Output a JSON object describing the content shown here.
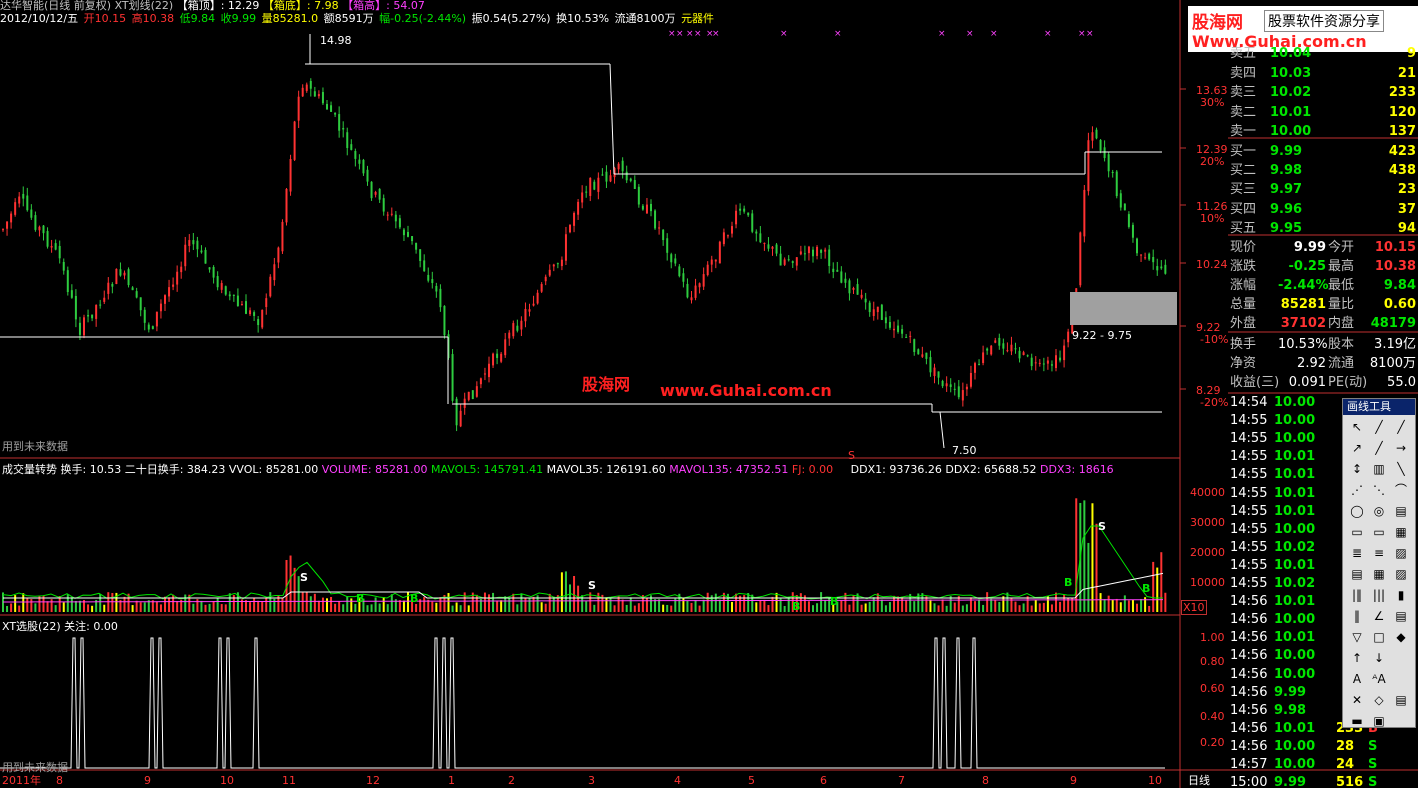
{
  "header": {
    "title": "达华智能(日线 前复权) XT划线(22)",
    "xiang_ding_label": "【箱顶】",
    "xiang_ding": "12.29",
    "xiang_di_label": "【箱底】",
    "xiang_di": "7.98",
    "xiang_gao_label": "【箱高】",
    "xiang_gao": "54.07"
  },
  "info": {
    "date": "2012/10/12/五",
    "open": "开10.15",
    "high": "高10.38",
    "low": "低9.84",
    "close": "收9.99",
    "vol": "量85281.0",
    "amount": "额8591万",
    "change": "幅-0.25(-2.44%)",
    "amp": "振0.54(5.27%)",
    "turnover": "换10.53%",
    "float": "流通8100万",
    "unit": "元器件"
  },
  "banner": {
    "site": "股海网",
    "slogan": "股票软件资源分享",
    "url": "Www.Guhai.com.cn"
  },
  "watermark": {
    "site": "股海网",
    "url": "www.Guhai.com.cn"
  },
  "main_labels": {
    "high_mark": "14.98",
    "low_mark": "7.50",
    "range": "9.22 - 9.75",
    "future_note": "用到未来数据",
    "s_mark": "S"
  },
  "price_axis": [
    {
      "v": "13.63",
      "p": "30%"
    },
    {
      "v": "12.39",
      "p": "20%"
    },
    {
      "v": "11.26",
      "p": "10%"
    },
    {
      "v": "10.24",
      "p": ""
    },
    {
      "v": "9.22",
      "p": "-10%"
    },
    {
      "v": "8.29",
      "p": "-20%"
    }
  ],
  "vol_header": {
    "name": "成交量转势",
    "hs": "换手: 10.53",
    "hs20": "二十日换手: 384.23",
    "vvol": "VVOL: 85281.00",
    "volume": "VOLUME: 85281.00",
    "mavol5": "MAVOL5: 145791.41",
    "mavol35": "MAVOL35: 126191.60",
    "mavol135": "MAVOL135: 47352.51",
    "fj": "FJ: 0.00",
    "ddx1": "DDX1: 93736.26",
    "ddx2": "DDX2: 65688.52",
    "ddx3": "DDX3: 18616"
  },
  "vol_axis": [
    "40000",
    "30000",
    "20000",
    "10000"
  ],
  "vol_unit": "X10",
  "xt_header": {
    "name": "XT选股(22)",
    "focus": "关注: 0.00"
  },
  "xt_axis": [
    "1.00",
    "0.80",
    "0.60",
    "0.40",
    "0.20"
  ],
  "date_axis": {
    "year": "2011年",
    "months": [
      "8",
      "9",
      "10",
      "11",
      "12",
      "1",
      "2",
      "3",
      "4",
      "5",
      "6",
      "7",
      "8",
      "9",
      "10"
    ],
    "period": "日线"
  },
  "quotes": {
    "sells": [
      {
        "l": "卖五",
        "p": "10.04",
        "v": "9"
      },
      {
        "l": "卖四",
        "p": "10.03",
        "v": "21"
      },
      {
        "l": "卖三",
        "p": "10.02",
        "v": "233"
      },
      {
        "l": "卖二",
        "p": "10.01",
        "v": "120"
      },
      {
        "l": "卖一",
        "p": "10.00",
        "v": "137"
      }
    ],
    "buys": [
      {
        "l": "买一",
        "p": "9.99",
        "v": "423"
      },
      {
        "l": "买二",
        "p": "9.98",
        "v": "438"
      },
      {
        "l": "买三",
        "p": "9.97",
        "v": "23"
      },
      {
        "l": "买四",
        "p": "9.96",
        "v": "37"
      },
      {
        "l": "买五",
        "p": "9.95",
        "v": "94"
      }
    ],
    "stats": [
      {
        "a": "现价",
        "av": "9.99",
        "b": "今开",
        "bv": "10.15"
      },
      {
        "a": "涨跌",
        "av": "-0.25",
        "b": "最高",
        "bv": "10.38"
      },
      {
        "a": "涨幅",
        "av": "-2.44%",
        "b": "最低",
        "bv": "9.84"
      },
      {
        "a": "总量",
        "av": "85281",
        "b": "量比",
        "bv": "0.60"
      },
      {
        "a": "外盘",
        "av": "37102",
        "b": "内盘",
        "bv": "48179"
      }
    ],
    "stats2": [
      {
        "a": "换手",
        "av": "10.53%",
        "b": "股本",
        "bv": "3.19亿"
      },
      {
        "a": "净资",
        "av": "2.92",
        "b": "流通",
        "bv": "8100万"
      },
      {
        "a": "收益(三)",
        "av": "0.091",
        "b": "PE(动)",
        "bv": "55.0"
      }
    ],
    "ticks": [
      {
        "t": "14:54",
        "p": "10.00"
      },
      {
        "t": "14:55",
        "p": "10.00"
      },
      {
        "t": "14:55",
        "p": "10.00"
      },
      {
        "t": "14:55",
        "p": "10.01"
      },
      {
        "t": "14:55",
        "p": "10.01"
      },
      {
        "t": "14:55",
        "p": "10.01"
      },
      {
        "t": "14:55",
        "p": "10.01"
      },
      {
        "t": "14:55",
        "p": "10.00"
      },
      {
        "t": "14:55",
        "p": "10.02"
      },
      {
        "t": "14:55",
        "p": "10.01"
      },
      {
        "t": "14:55",
        "p": "10.02"
      },
      {
        "t": "14:56",
        "p": "10.01"
      },
      {
        "t": "14:56",
        "p": "10.00"
      },
      {
        "t": "14:56",
        "p": "10.01"
      },
      {
        "t": "14:56",
        "p": "10.00"
      },
      {
        "t": "14:56",
        "p": "10.00"
      },
      {
        "t": "14:56",
        "p": "9.99"
      },
      {
        "t": "14:56",
        "p": "9.98"
      },
      {
        "t": "14:56",
        "p": "10.01",
        "v": "233",
        "s": "B"
      },
      {
        "t": "14:56",
        "p": "10.00",
        "v": "28",
        "s": "S"
      },
      {
        "t": "14:57",
        "p": "10.00",
        "v": "24",
        "s": "S"
      },
      {
        "t": "15:00",
        "p": "9.99",
        "v": "516",
        "s": "S"
      }
    ]
  },
  "tools": {
    "title": "画线工具",
    "items": [
      "↖",
      "╱",
      "╱",
      "↗",
      "╱",
      "→",
      "↕",
      "▥",
      "╲",
      "⋰",
      "⋱",
      "⌒",
      "◯",
      "◎",
      "▤",
      "▭",
      "▭",
      "▦",
      "≣",
      "≡",
      "▨",
      "▤",
      "▦",
      "▨",
      "|‖",
      "|||",
      "▮",
      "‖",
      "∠",
      "▤",
      "▽",
      "□",
      "◆",
      "↑",
      "↓",
      "",
      "A",
      "ᴬA",
      "",
      "✕",
      "◇",
      "▤",
      "▬",
      "▣",
      ""
    ]
  }
}
